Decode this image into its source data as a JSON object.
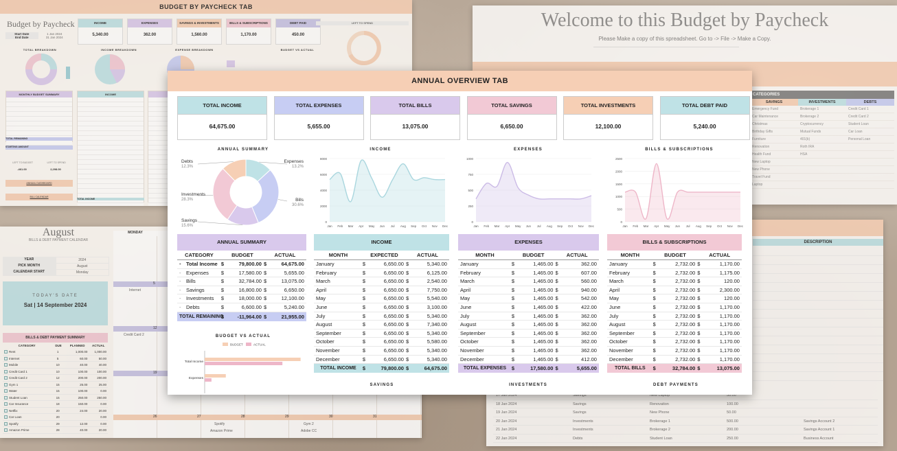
{
  "top_left": {
    "banner": "BUDGET BY PAYCHECK TAB",
    "title": "Budget by Paycheck",
    "start_label": "Start Date",
    "start_value": "1 Jan 2024",
    "end_label": "End Date",
    "end_value": "31 Jan 2024",
    "cards": [
      {
        "label": "INCOME",
        "value": "5,340.00",
        "color": "#bfe2e6"
      },
      {
        "label": "EXPENSES",
        "value": "362.00",
        "color": "#d9c9ec"
      },
      {
        "label": "SAVINGS & INVESTMENTS",
        "value": "1,560.00",
        "color": "#f6cfb5"
      },
      {
        "label": "BILLS & SUBSCRIPTIONS",
        "value": "1,170.00",
        "color": "#f2c9d5"
      },
      {
        "label": "DEBT PAID",
        "value": "450.00",
        "color": "#c7c4e6"
      }
    ],
    "left_to_spend": "LEFT TO SPEND",
    "charts": [
      "TOTAL BREAKDOWN",
      "INCOME BREAKDOWN",
      "EXPENSE BREAKDOWN",
      "BUDGET VS ACTUAL"
    ],
    "monthly_summary": "MONTHLY BUDGET SUMMARY",
    "income_hd": "INCOME",
    "total_remaining": "TOTAL REMAINING",
    "starting_amount": "STARTING AMOUNT",
    "left_to_budget": "LEFT TO BUDGET",
    "left_to_spend2": "LEFT TO SPEND",
    "ltb_value": "-461.00",
    "lts_value": "2,298.00",
    "annual_dashboard": "ANNUAL DASHBOARD",
    "bill_calendar": "BILL CALENDAR",
    "total_income": "TOTAL INCOME"
  },
  "top_right": {
    "welcome": "Welcome to this Budget by Paycheck",
    "sub": "Please Make a copy of this spreadsheet. Go to -> File -> Make a Copy.",
    "categories": "CATEGORIES",
    "savings_hd": "SAVINGS",
    "investments_hd": "INVESTMENTS",
    "debts_hd": "DEBTS",
    "savings": [
      "Emergency Fund",
      "Car Maintenance",
      "Christmas",
      "Birthday Gifts",
      "Furniture",
      "Renovation",
      "Health Fund",
      "New Laptop",
      "New Phone",
      "Travel Fund",
      "Laptop"
    ],
    "investments": [
      "Brokerage 1",
      "Brokerage 2",
      "Cryptocurrency",
      "Mutual Funds",
      "401(k)",
      "Roth IRA",
      "HSA",
      "",
      "",
      "",
      ""
    ],
    "debts": [
      "Credit Card 1",
      "Credit Card 2",
      "Student Loan",
      "Car Loan",
      "Personal Loan",
      "",
      "",
      "",
      "",
      "",
      ""
    ]
  },
  "bottom_left": {
    "month": "August",
    "caption": "BILLS & DEBT PAYMENT CALENDAR",
    "year_label": "YEAR",
    "year_value": "2024",
    "pick_label": "PICK MONTH",
    "pick_value": "August",
    "start_label": "CALENDAR START",
    "start_value": "Monday",
    "today_label": "TODAY'S DATE",
    "today_value": "Sat | 14 September 2024",
    "summary_hd": "BILLS & DEBT PAYMENT SUMMARY",
    "cols": [
      "CATEGORY",
      "DUE",
      "PLANNED",
      "ACTUAL"
    ],
    "rows": [
      [
        "Rent",
        "1",
        "1,000.00",
        "1,000.00"
      ],
      [
        "Internet",
        "5",
        "60.00",
        "50.00"
      ],
      [
        "Mobile",
        "10",
        "40.00",
        "40.00"
      ],
      [
        "Credit Card 1",
        "10",
        "100.00",
        "100.00"
      ],
      [
        "Credit Card 2",
        "12",
        "200.00",
        "200.00"
      ],
      [
        "Gym 1",
        "15",
        "25.00",
        "25.00"
      ],
      [
        "Water",
        "15",
        "100.00",
        "0.00"
      ],
      [
        "Student Loan",
        "15",
        "250.00",
        "250.00"
      ],
      [
        "Car Insurance",
        "18",
        "150.00",
        "0.00"
      ],
      [
        "Netflix",
        "20",
        "24.00",
        "20.00"
      ],
      [
        "Car Loan",
        "20",
        "",
        "0.00"
      ],
      [
        "Spotify",
        "29",
        "12.00",
        "0.00"
      ],
      [
        "Amazon Prime",
        "28",
        "40.00",
        "20.00"
      ]
    ],
    "monday": "MONDAY",
    "notes": [
      "Internet",
      "Credit Card 2",
      "Spotify",
      "Amazon Prime",
      "Gym 2",
      "Adobe CC"
    ],
    "days": [
      "5",
      "12",
      "19",
      "26",
      "27",
      "28",
      "29",
      "30",
      "31"
    ]
  },
  "bottom_right": {
    "description": "DESCRIPTION",
    "rows": [
      [
        "17 Jan 2024",
        "Savings",
        "New Laptop",
        "50.00",
        ""
      ],
      [
        "18 Jan 2024",
        "Savings",
        "Renovation",
        "100.00",
        ""
      ],
      [
        "19 Jan 2024",
        "Savings",
        "New Phone",
        "50.00",
        ""
      ],
      [
        "20 Jan 2024",
        "Investments",
        "Brokerage 1",
        "500.00",
        "Savings Account 2"
      ],
      [
        "21 Jan 2024",
        "Investments",
        "Brokerage 2",
        "200.00",
        "Savings Account 1"
      ],
      [
        "22 Jan 2024",
        "Debts",
        "Student Loan",
        "250.00",
        "Business Account"
      ]
    ]
  },
  "main": {
    "banner": "ANNUAL OVERVIEW TAB",
    "cards": [
      {
        "label": "TOTAL INCOME",
        "value": "64,675.00",
        "color": "#bfe2e6"
      },
      {
        "label": "TOTAL EXPENSES",
        "value": "5,655.00",
        "color": "#c7cdf3"
      },
      {
        "label": "TOTAL BILLS",
        "value": "13,075.00",
        "color": "#d9c9ec"
      },
      {
        "label": "TOTAL SAVINGS",
        "value": "6,650.00",
        "color": "#f2c9d5"
      },
      {
        "label": "TOTAL INVESTMENTS",
        "value": "12,100.00",
        "color": "#f6cfb5"
      },
      {
        "label": "TOTAL DEBT PAID",
        "value": "5,240.00",
        "color": "#bfe2e6"
      }
    ],
    "charts_titles": {
      "annual": "ANNUAL SUMMARY",
      "income": "INCOME",
      "expenses": "EXPENSES",
      "bills": "BILLS & SUBSCRIPTIONS",
      "bva": "BUDGET VS ACTUAL",
      "savings": "SAVINGS",
      "investments": "INVESTMENTS",
      "debt": "DEBT PAYMENTS"
    },
    "annual_summary": {
      "header": "ANNUAL SUMMARY",
      "cols": [
        "CATEGORY",
        "BUDGET",
        "ACTUAL"
      ],
      "rows": [
        {
          "bullet": "•",
          "name": "Total Income",
          "budget": "79,800.00",
          "actual": "64,675.00",
          "bold": true
        },
        {
          "bullet": "-",
          "name": "Expenses",
          "budget": "17,580.00",
          "actual": "5,655.00"
        },
        {
          "bullet": "-",
          "name": "Bills",
          "budget": "32,784.00",
          "actual": "13,075.00"
        },
        {
          "bullet": "-",
          "name": "Savings",
          "budget": "16,800.00",
          "actual": "6,650.00"
        },
        {
          "bullet": "-",
          "name": "Investments",
          "budget": "18,000.00",
          "actual": "12,100.00"
        },
        {
          "bullet": "-",
          "name": "Debts",
          "budget": "6,600.00",
          "actual": "5,240.00"
        }
      ],
      "footer": {
        "name": "TOTAL REMAINING",
        "budget": "-11,964.00",
        "actual": "21,955.00"
      }
    },
    "income_table": {
      "header": "INCOME",
      "cols": [
        "MONTH",
        "EXPECTED",
        "ACTUAL"
      ],
      "rows": [
        [
          "January",
          "6,650.00",
          "5,340.00"
        ],
        [
          "February",
          "6,650.00",
          "6,125.00"
        ],
        [
          "March",
          "6,650.00",
          "2,540.00"
        ],
        [
          "April",
          "6,650.00",
          "7,750.00"
        ],
        [
          "May",
          "6,650.00",
          "5,540.00"
        ],
        [
          "June",
          "6,650.00",
          "3,100.00"
        ],
        [
          "July",
          "6,650.00",
          "5,340.00"
        ],
        [
          "August",
          "6,650.00",
          "7,340.00"
        ],
        [
          "September",
          "6,650.00",
          "5,340.00"
        ],
        [
          "October",
          "6,650.00",
          "5,580.00"
        ],
        [
          "November",
          "6,650.00",
          "5,340.00"
        ],
        [
          "December",
          "6,650.00",
          "5,340.00"
        ]
      ],
      "footer": [
        "TOTAL INCOME",
        "79,800.00",
        "64,675.00"
      ]
    },
    "expenses_table": {
      "header": "EXPENSES",
      "cols": [
        "MONTH",
        "BUDGET",
        "ACTUAL"
      ],
      "rows": [
        [
          "January",
          "1,465.00",
          "362.00"
        ],
        [
          "February",
          "1,465.00",
          "607.00"
        ],
        [
          "March",
          "1,465.00",
          "560.00"
        ],
        [
          "April",
          "1,465.00",
          "940.00"
        ],
        [
          "May",
          "1,465.00",
          "542.00"
        ],
        [
          "June",
          "1,465.00",
          "422.00"
        ],
        [
          "July",
          "1,465.00",
          "362.00"
        ],
        [
          "August",
          "1,465.00",
          "362.00"
        ],
        [
          "September",
          "1,465.00",
          "362.00"
        ],
        [
          "October",
          "1,465.00",
          "362.00"
        ],
        [
          "November",
          "1,465.00",
          "362.00"
        ],
        [
          "December",
          "1,465.00",
          "412.00"
        ]
      ],
      "footer": [
        "TOTAL EXPENSES",
        "17,580.00",
        "5,655.00"
      ]
    },
    "bills_table": {
      "header": "BILLS & SUBSCRIPTIONS",
      "cols": [
        "MONTH",
        "BUDGET",
        "ACTUAL"
      ],
      "rows": [
        [
          "January",
          "2,732.00",
          "1,170.00"
        ],
        [
          "February",
          "2,732.00",
          "1,175.00"
        ],
        [
          "March",
          "2,732.00",
          "120.00"
        ],
        [
          "April",
          "2,732.00",
          "2,300.00"
        ],
        [
          "May",
          "2,732.00",
          "120.00"
        ],
        [
          "June",
          "2,732.00",
          "1,170.00"
        ],
        [
          "July",
          "2,732.00",
          "1,170.00"
        ],
        [
          "August",
          "2,732.00",
          "1,170.00"
        ],
        [
          "September",
          "2,732.00",
          "1,170.00"
        ],
        [
          "October",
          "2,732.00",
          "1,170.00"
        ],
        [
          "November",
          "2,732.00",
          "1,170.00"
        ],
        [
          "December",
          "2,732.00",
          "1,170.00"
        ]
      ],
      "footer": [
        "TOTAL BILLS",
        "32,784.00",
        "13,075.00"
      ]
    },
    "currency": "$"
  },
  "chart_data": [
    {
      "type": "pie",
      "title": "ANNUAL SUMMARY",
      "labels": [
        "Debts",
        "Expenses",
        "Bills",
        "Savings",
        "Investments"
      ],
      "label_values": [
        "12.3%",
        "13.2%",
        "30.6%",
        "15.6%",
        "28.3%"
      ],
      "values": [
        12.3,
        13.2,
        30.6,
        15.6,
        28.3
      ],
      "colors": [
        "#f6cfb5",
        "#bfe2e6",
        "#c7cdf3",
        "#d9c9ec",
        "#f2c9d5"
      ]
    },
    {
      "type": "area",
      "title": "INCOME",
      "categories": [
        "Jan",
        "Feb",
        "Mar",
        "Apr",
        "May",
        "Jun",
        "Jul",
        "Aug",
        "Sep",
        "Oct",
        "Nov",
        "Dec"
      ],
      "values": [
        5340,
        6125,
        2540,
        7750,
        5540,
        3100,
        5340,
        7340,
        5340,
        5580,
        5340,
        5340
      ],
      "yticks": [
        "0",
        "2000",
        "4000",
        "6000",
        "8000"
      ],
      "ylim": [
        0,
        8000
      ],
      "color": "#a9d6de"
    },
    {
      "type": "area",
      "title": "EXPENSES",
      "categories": [
        "Jan",
        "Feb",
        "Mar",
        "Apr",
        "May",
        "Jun",
        "Jul",
        "Aug",
        "Sep",
        "Oct",
        "Nov",
        "Dec"
      ],
      "values": [
        362,
        607,
        560,
        940,
        542,
        422,
        362,
        362,
        362,
        362,
        362,
        412
      ],
      "yticks": [
        "0",
        "250",
        "500",
        "750",
        "1000"
      ],
      "ylim": [
        0,
        1000
      ],
      "color": "#cbbbe6"
    },
    {
      "type": "area",
      "title": "BILLS & SUBSCRIPTIONS",
      "categories": [
        "Jan",
        "Feb",
        "Mar",
        "Apr",
        "May",
        "Jun",
        "Jul",
        "Aug",
        "Sep",
        "Oct",
        "Nov",
        "Dec"
      ],
      "values": [
        1170,
        1175,
        120,
        2300,
        120,
        1170,
        1170,
        1170,
        1170,
        1170,
        1170,
        1170
      ],
      "yticks": [
        "0",
        "500",
        "1000",
        "1500",
        "2000",
        "2500"
      ],
      "ylim": [
        0,
        2500
      ],
      "color": "#eeb6c8"
    },
    {
      "type": "bar",
      "title": "BUDGET VS ACTUAL",
      "legend": [
        "BUDGET",
        "ACTUAL"
      ],
      "categories": [
        "Total Income",
        "Expenses"
      ],
      "series": [
        {
          "name": "BUDGET",
          "values": [
            79800,
            17580
          ],
          "color": "#f6cfb5"
        },
        {
          "name": "ACTUAL",
          "values": [
            64675,
            5655
          ],
          "color": "#eeb6c8"
        }
      ],
      "xlim": [
        0,
        80000
      ]
    }
  ]
}
